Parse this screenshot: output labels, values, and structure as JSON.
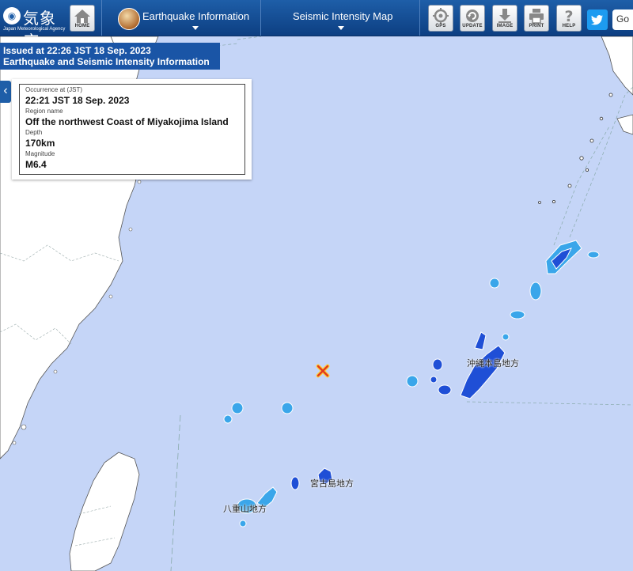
{
  "header": {
    "logo_kanji": "気象庁",
    "logo_sub": "Japan Meteorological Agency",
    "home_label": "HOME",
    "menu1_label": "Earthquake Information",
    "menu2_label": "Seismic Intensity Map",
    "tools": [
      {
        "icon": "gps-icon",
        "label": "GPS"
      },
      {
        "icon": "update-icon",
        "label": "UPDATE"
      },
      {
        "icon": "image-download-icon",
        "label": "IMAGE"
      },
      {
        "icon": "print-icon",
        "label": "PRINT"
      },
      {
        "icon": "help-icon",
        "label": "HELP"
      }
    ],
    "search_text": "Go"
  },
  "issued": {
    "line1": "Issued at 22:26 JST 18 Sep. 2023",
    "line2": "Earthquake and Seismic Intensity Information"
  },
  "info": {
    "occurrence_label": "Occurrence at (JST)",
    "occurrence_value": "22:21 JST 18 Sep. 2023",
    "region_label": "Region name",
    "region_value": "Off the northwest Coast of Miyakojima Island",
    "depth_label": "Depth",
    "depth_value": "170km",
    "magnitude_label": "Magnitude",
    "magnitude_value": "M6.4"
  },
  "map": {
    "region_labels": {
      "okinawa": "沖縄本島地方",
      "miyako": "宮古島地方",
      "yaeyama": "八重山地方"
    },
    "epicenter_icon": "epicenter-x-icon",
    "colors": {
      "sea": "#c5d5f7",
      "land": "#ffffff",
      "intensity_light": "#3aa6ea",
      "intensity_dark": "#1f4fd6",
      "epicenter": "#e23a1f"
    }
  }
}
